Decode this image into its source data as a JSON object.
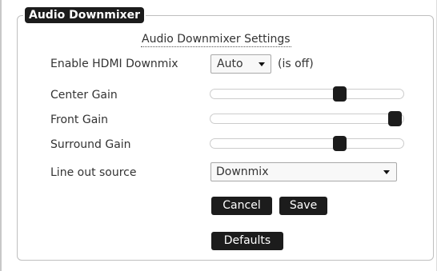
{
  "panel": {
    "legend": "Audio Downmixer",
    "settings_title": "Audio Downmixer Settings"
  },
  "hdmi_downmix": {
    "label": "Enable HDMI Downmix",
    "selected": "Auto",
    "status": "(is off)"
  },
  "sliders": [
    {
      "label": "Center Gain",
      "level": 0.67
    },
    {
      "label": "Front Gain",
      "level": 0.955
    },
    {
      "label": "Surround Gain",
      "level": 0.67
    }
  ],
  "line_out": {
    "label": "Line out source",
    "selected": "Downmix"
  },
  "buttons": {
    "cancel": "Cancel",
    "save": "Save",
    "defaults": "Defaults"
  },
  "colors": {
    "button_bg": "#1c1c1c",
    "button_text": "#ffffff",
    "text": "#333333"
  },
  "icons": {
    "dropdown": "chevron-down-icon"
  }
}
